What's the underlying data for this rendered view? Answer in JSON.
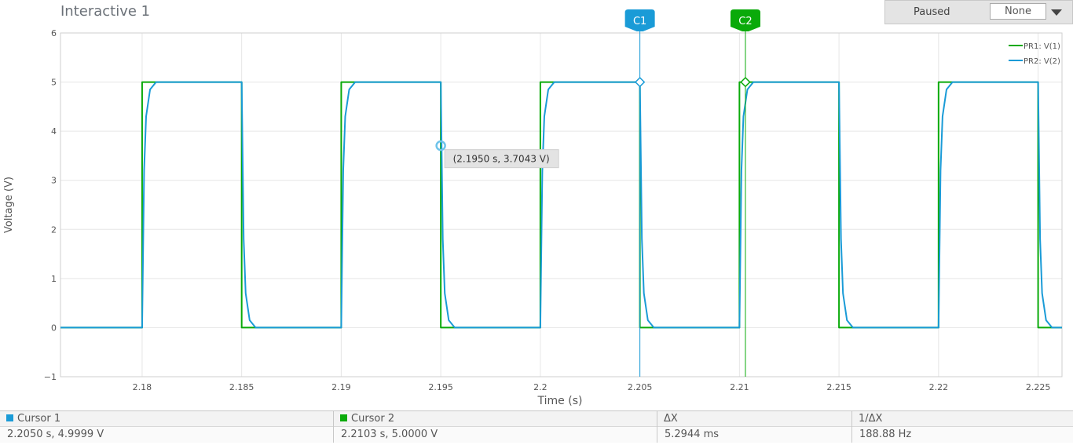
{
  "window": {
    "title": "Interactive 1"
  },
  "controls": {
    "status": "Paused",
    "dropdown_value": "None"
  },
  "colors": {
    "v1": "#0aaa0a",
    "v2": "#1a9bd7",
    "cursor1": "#1a9bd7",
    "cursor2": "#0aaa0a",
    "grid": "#e6e6e6",
    "axis_text": "#555555"
  },
  "chart_data": {
    "type": "line",
    "xlabel": "Time (s)",
    "ylabel": "Voltage (V)",
    "xlim": [
      2.1759,
      2.2262
    ],
    "ylim": [
      -1,
      6
    ],
    "x_ticks": [
      2.18,
      2.185,
      2.19,
      2.195,
      2.2,
      2.205,
      2.21,
      2.215,
      2.22,
      2.225
    ],
    "x_tick_labels": [
      "2.18",
      "2.185",
      "2.19",
      "2.195",
      "2.2",
      "2.205",
      "2.21",
      "2.215",
      "2.22",
      "2.225"
    ],
    "y_ticks": [
      -1,
      0,
      1,
      2,
      3,
      4,
      5,
      6
    ],
    "y_tick_labels": [
      "−1",
      "0",
      "1",
      "2",
      "3",
      "4",
      "5",
      "6"
    ],
    "grid": true,
    "legend_position": "top-right",
    "series": [
      {
        "name": "PR1: V(1)",
        "x": [
          2.1759,
          2.18,
          2.18,
          2.185,
          2.185,
          2.19,
          2.19,
          2.195,
          2.195,
          2.2,
          2.2,
          2.205,
          2.205,
          2.21,
          2.21,
          2.215,
          2.215,
          2.22,
          2.22,
          2.225,
          2.225,
          2.2262
        ],
        "y": [
          0,
          0,
          5,
          5,
          0,
          0,
          5,
          5,
          0,
          0,
          5,
          5,
          0,
          0,
          5,
          5,
          0,
          0,
          5,
          5,
          0,
          0
        ]
      },
      {
        "name": "PR2: V(2)",
        "x": [
          2.1759,
          2.18,
          2.1801,
          2.1802,
          2.1804,
          2.1807,
          2.185,
          2.1851,
          2.1852,
          2.1854,
          2.1857,
          2.19,
          2.1901,
          2.1902,
          2.1904,
          2.1907,
          2.195,
          2.1951,
          2.1952,
          2.1954,
          2.1957,
          2.2,
          2.2001,
          2.2002,
          2.2004,
          2.2007,
          2.205,
          2.2051,
          2.2052,
          2.2054,
          2.2057,
          2.21,
          2.2101,
          2.2102,
          2.2104,
          2.2107,
          2.215,
          2.2151,
          2.2152,
          2.2154,
          2.2157,
          2.22,
          2.2201,
          2.2202,
          2.2204,
          2.2207,
          2.225,
          2.2251,
          2.2252,
          2.2254,
          2.2257,
          2.2262
        ],
        "y": [
          0,
          0,
          3.2,
          4.3,
          4.85,
          5,
          5,
          1.8,
          0.7,
          0.15,
          0,
          0,
          3.2,
          4.3,
          4.85,
          5,
          5,
          1.8,
          0.7,
          0.15,
          0,
          0,
          3.2,
          4.3,
          4.85,
          5,
          5,
          1.8,
          0.7,
          0.15,
          0,
          0,
          3.2,
          4.3,
          4.85,
          5,
          5,
          1.8,
          0.7,
          0.15,
          0,
          0,
          3.2,
          4.3,
          4.85,
          5,
          5,
          1.8,
          0.7,
          0.15,
          0,
          0
        ]
      }
    ],
    "cursors": [
      {
        "label": "C1",
        "x": 2.205,
        "y": 4.9999
      },
      {
        "label": "C2",
        "x": 2.2103,
        "y": 5.0
      }
    ],
    "hover_marker": {
      "x": 2.195,
      "y": 3.7043,
      "label": "(2.1950 s, 3.7043 V)"
    }
  },
  "footer": {
    "cursor1": {
      "header": "Cursor 1",
      "value": "2.2050 s, 4.9999 V"
    },
    "cursor2": {
      "header": "Cursor 2",
      "value": "2.2103 s, 5.0000 V"
    },
    "dx": {
      "header": "ΔX",
      "value": "5.2944 ms"
    },
    "inv_dx": {
      "header": "1/ΔX",
      "value": "188.88 Hz"
    }
  }
}
